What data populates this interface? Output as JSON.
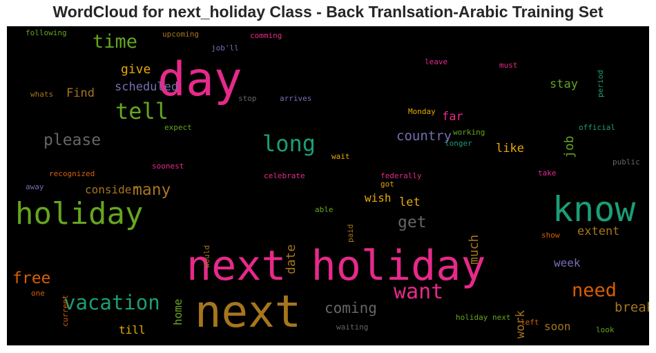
{
  "title": "WordCloud for next_holiday Class - Back Tranlsation-Arabic Training Set",
  "colors": {
    "background": "#000000",
    "pink": "#e7298a",
    "teal": "#1b9e77",
    "olive": "#66a61e",
    "gold": "#a6761d",
    "yellow": "#e6ab02",
    "orange": "#d95f02",
    "purple": "#7570b3",
    "gray": "#666666"
  },
  "words": [
    "next holiday",
    "next",
    "day",
    "know",
    "holiday",
    "tell",
    "long",
    "time",
    "vacation",
    "want",
    "need",
    "please",
    "free",
    "many",
    "get",
    "coming",
    "break",
    "soon",
    "till",
    "job",
    "much",
    "date",
    "work",
    "home",
    "period",
    "paid",
    "would",
    "current",
    "give",
    "scheduled",
    "Find",
    "country",
    "far",
    "like",
    "stay",
    "let",
    "wish",
    "consider",
    "extent",
    "week",
    "following",
    "upcoming",
    "comming",
    "job'll",
    "leave",
    "must",
    "whats",
    "stop",
    "arrives",
    "Monday",
    "expect",
    "working",
    "longer",
    "official",
    "wait",
    "soonest",
    "federally",
    "public",
    "recognized",
    "celebrate",
    "got",
    "take",
    "away",
    "able",
    "show",
    "one",
    "waiting",
    "holiday next",
    "left",
    "look"
  ]
}
